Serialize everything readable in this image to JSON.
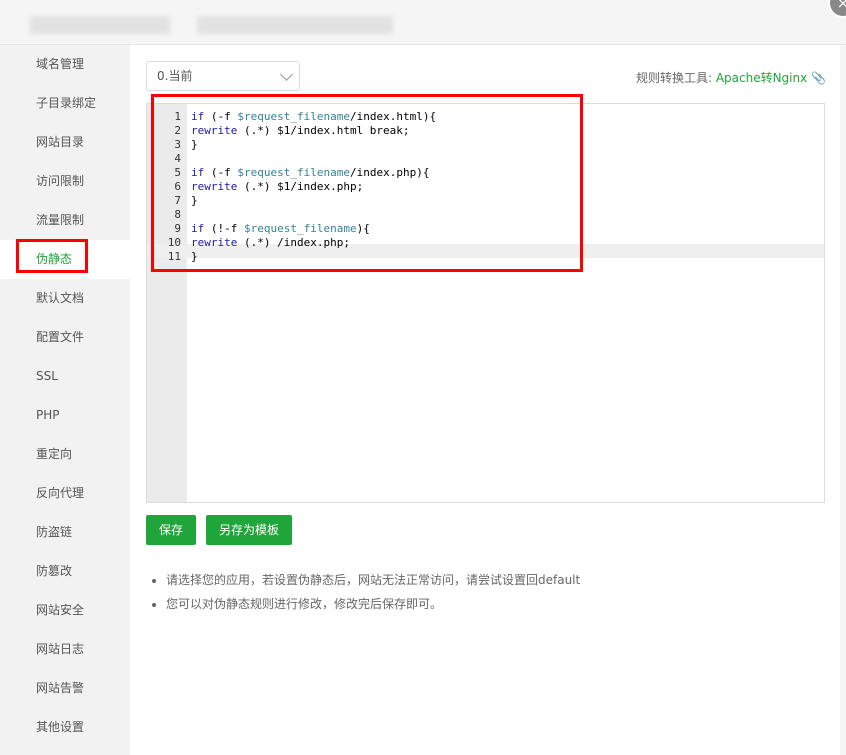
{
  "window": {
    "close_symbol": "×"
  },
  "sidebar": {
    "items": [
      {
        "label": "域名管理",
        "active": false
      },
      {
        "label": "子目录绑定",
        "active": false
      },
      {
        "label": "网站目录",
        "active": false
      },
      {
        "label": "访问限制",
        "active": false
      },
      {
        "label": "流量限制",
        "active": false
      },
      {
        "label": "伪静态",
        "active": true
      },
      {
        "label": "默认文档",
        "active": false
      },
      {
        "label": "配置文件",
        "active": false
      },
      {
        "label": "SSL",
        "active": false
      },
      {
        "label": "PHP",
        "active": false
      },
      {
        "label": "重定向",
        "active": false
      },
      {
        "label": "反向代理",
        "active": false
      },
      {
        "label": "防盗链",
        "active": false
      },
      {
        "label": "防篡改",
        "active": false
      },
      {
        "label": "网站安全",
        "active": false
      },
      {
        "label": "网站日志",
        "active": false
      },
      {
        "label": "网站告警",
        "active": false
      },
      {
        "label": "其他设置",
        "active": false
      }
    ]
  },
  "main": {
    "template_select": {
      "value": "0.当前"
    },
    "converter": {
      "label": "规则转换工具:",
      "link": "Apache转Nginx",
      "icon": "link-icon"
    },
    "editor": {
      "active_line": 11,
      "lines": [
        "if (-f $request_filename/index.html){",
        "rewrite (.*) $1/index.html break;",
        "}",
        "",
        "if (-f $request_filename/index.php){",
        "rewrite (.*) $1/index.php;",
        "}",
        "",
        "if (!-f $request_filename){",
        "rewrite (.*) /index.php;",
        "}"
      ]
    },
    "buttons": {
      "save": "保存",
      "save_as_template": "另存为模板"
    },
    "notes": [
      "请选择您的应用，若设置伪静态后，网站无法正常访问，请尝试设置回default",
      "您可以对伪静态规则进行修改，修改完后保存即可。"
    ]
  },
  "colors": {
    "accent": "#20a53a",
    "highlight": "#ff0000"
  }
}
